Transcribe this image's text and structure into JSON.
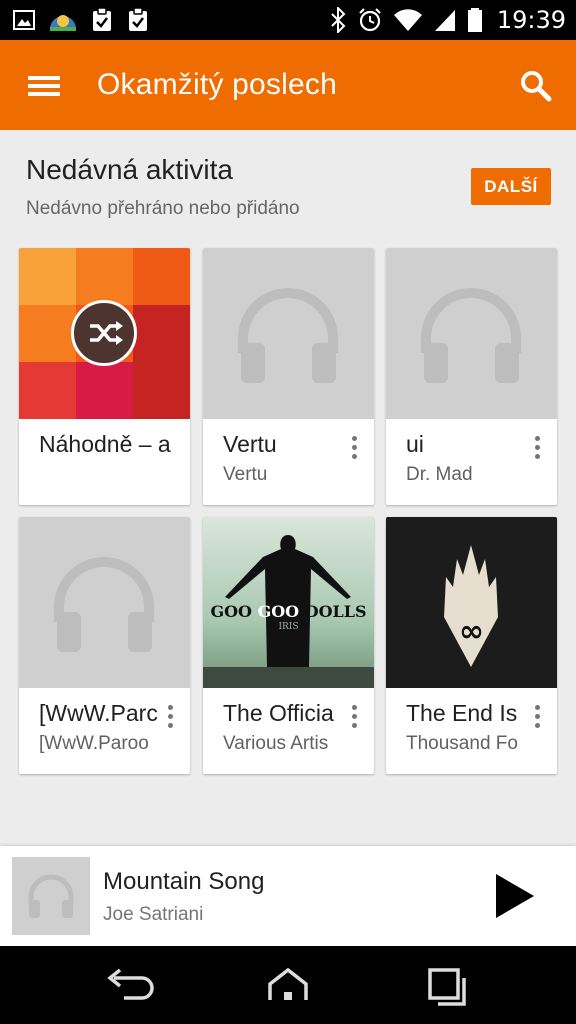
{
  "status_bar": {
    "time": "19:39",
    "left_icons": [
      "image-icon",
      "weather-icon",
      "clipboard-check-icon",
      "clipboard-check-icon"
    ],
    "right_icons": [
      "bluetooth-icon",
      "alarm-icon",
      "wifi-icon",
      "signal-icon",
      "battery-icon"
    ]
  },
  "toolbar": {
    "title": "Okamžitý poslech",
    "menu_icon": "hamburger-menu-icon",
    "search_icon": "search-icon"
  },
  "section": {
    "title": "Nedávná aktivita",
    "subtitle": "Nedávno přehráno nebo přidáno",
    "more_label": "DALŠÍ"
  },
  "cards": [
    {
      "title": "Náhodně – a",
      "subtitle": "",
      "art": "shuffle-mosaic"
    },
    {
      "title": "Vertu",
      "subtitle": "Vertu",
      "art": "headphones-placeholder"
    },
    {
      "title": "ui",
      "subtitle": "Dr. Mad",
      "art": "headphones-placeholder"
    },
    {
      "title": "[WwW.Parc",
      "subtitle": "[WwW.Paroo",
      "art": "headphones-placeholder"
    },
    {
      "title": "The Officia",
      "subtitle": "Various Artis",
      "art": "goo-goo-dolls-cover"
    },
    {
      "title": "The End Is",
      "subtitle": "Thousand Fo",
      "art": "thousand-foot-krutch-cover"
    }
  ],
  "album_art_text": {
    "goo_band": "GOO GOO DOLLS",
    "goo_band_1": "GOO",
    "goo_band_2": "GOO",
    "goo_band_3": "DOLLS",
    "goo_album": "IRIS"
  },
  "now_playing": {
    "title": "Mountain Song",
    "artist": "Joe Satriani",
    "play_icon": "play-icon"
  },
  "nav_bar": {
    "icons": [
      "back-icon",
      "home-icon",
      "recents-icon"
    ]
  },
  "colors": {
    "accent": "#ef6c00",
    "background": "#ececec",
    "placeholder": "#cfcfcf",
    "placeholder_icon": "#bdbdbd"
  }
}
